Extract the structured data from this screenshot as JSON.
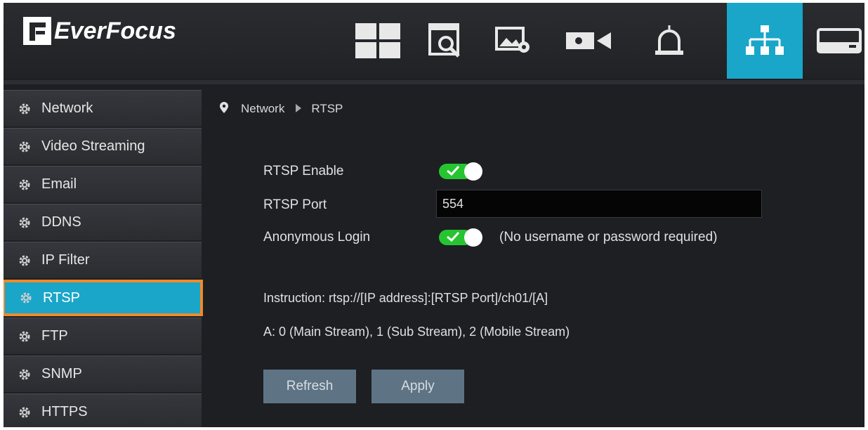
{
  "brand": {
    "name": "EverFocus"
  },
  "topnav": {
    "icons": [
      "live-view-grid-icon",
      "playback-icon",
      "image-settings-icon",
      "camera-icon",
      "alarm-icon",
      "network-icon",
      "storage-icon"
    ],
    "active": "network-icon",
    "accent_color": "#19a6c9"
  },
  "sidebar": {
    "items": [
      {
        "label": "Network"
      },
      {
        "label": "Video Streaming"
      },
      {
        "label": "Email"
      },
      {
        "label": "DDNS"
      },
      {
        "label": "IP Filter"
      },
      {
        "label": "RTSP",
        "selected": true
      },
      {
        "label": "FTP"
      },
      {
        "label": "SNMP"
      },
      {
        "label": "HTTPS"
      }
    ],
    "highlight_color": "#f08a2a"
  },
  "breadcrumb": {
    "parent": "Network",
    "current": "RTSP"
  },
  "form": {
    "rtsp_enable_label": "RTSP Enable",
    "rtsp_enable": true,
    "rtsp_port_label": "RTSP Port",
    "rtsp_port_value": "554",
    "anonymous_login_label": "Anonymous Login",
    "anonymous_login": true,
    "anonymous_login_hint": "(No username or password required)"
  },
  "instruction": {
    "line1": "Instruction: rtsp://[IP address]:[RTSP Port]/ch01/[A]",
    "line2": "A: 0 (Main Stream), 1 (Sub Stream), 2 (Mobile Stream)"
  },
  "buttons": {
    "refresh": "Refresh",
    "apply": "Apply"
  },
  "toggle_on_color": "#27c431"
}
